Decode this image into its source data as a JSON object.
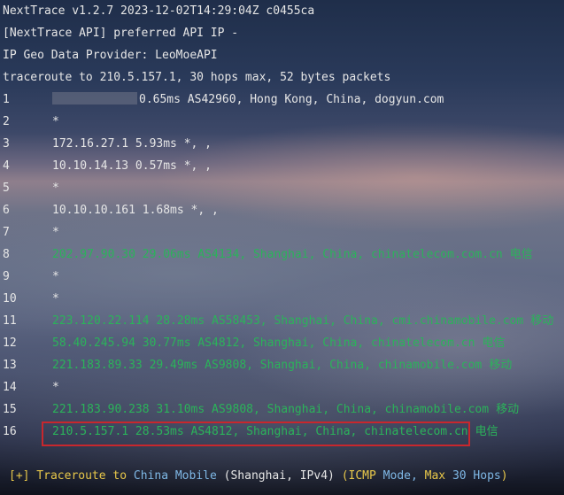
{
  "header": {
    "version_line": "NextTrace v1.2.7 2023-12-02T14:29:04Z c0455ca",
    "api_line": "[NextTrace API] preferred API IP -",
    "geo_line": "IP Geo Data Provider: LeoMoeAPI",
    "traceroute_line": "traceroute to 210.5.157.1, 30 hops max, 52 bytes packets"
  },
  "hops": [
    {
      "num": "1",
      "text": "0.65ms AS42960, Hong Kong, China, dogyun.com",
      "color": "#e6e6e6",
      "carrier": "",
      "masked": true
    },
    {
      "num": "2",
      "text": "*",
      "color": "#e6e6e6",
      "carrier": "",
      "masked": false
    },
    {
      "num": "3",
      "text": "172.16.27.1 5.93ms *, ,",
      "color": "#e6e6e6",
      "carrier": "",
      "masked": false
    },
    {
      "num": "4",
      "text": "10.10.14.13 0.57ms *, ,",
      "color": "#e6e6e6",
      "carrier": "",
      "masked": false
    },
    {
      "num": "5",
      "text": "*",
      "color": "#e6e6e6",
      "carrier": "",
      "masked": false
    },
    {
      "num": "6",
      "text": "10.10.10.161 1.68ms *, ,",
      "color": "#e6e6e6",
      "carrier": "",
      "masked": false
    },
    {
      "num": "7",
      "text": "*",
      "color": "#e6e6e6",
      "carrier": "",
      "masked": false
    },
    {
      "num": "8",
      "text": "202.97.90.30 29.06ms AS4134, Shanghai, China, chinatelecom.com.cn",
      "color": "#2bb35a",
      "carrier": "电信",
      "masked": false
    },
    {
      "num": "9",
      "text": "*",
      "color": "#e6e6e6",
      "carrier": "",
      "masked": false
    },
    {
      "num": "10",
      "text": "*",
      "color": "#e6e6e6",
      "carrier": "",
      "masked": false
    },
    {
      "num": "11",
      "text": "223.120.22.114 28.28ms AS58453, Shanghai, China, cmi.chinamobile.com",
      "color": "#2bb35a",
      "carrier": "移动",
      "masked": false
    },
    {
      "num": "12",
      "text": "58.40.245.94 30.77ms AS4812, Shanghai, China, chinatelecom.cn",
      "color": "#2bb35a",
      "carrier": "电信",
      "masked": false
    },
    {
      "num": "13",
      "text": "221.183.89.33 29.49ms AS9808, Shanghai, China, chinamobile.com",
      "color": "#2bb35a",
      "carrier": "移动",
      "masked": false
    },
    {
      "num": "14",
      "text": "*",
      "color": "#e6e6e6",
      "carrier": "",
      "masked": false
    },
    {
      "num": "15",
      "text": "221.183.90.238 31.10ms AS9808, Shanghai, China, chinamobile.com",
      "color": "#2bb35a",
      "carrier": "移动",
      "masked": false
    },
    {
      "num": "16",
      "text": "210.5.157.1 28.53ms AS4812, Shanghai, China, chinatelecom.cn",
      "color": "#2bb35a",
      "carrier": "电信",
      "masked": false
    }
  ],
  "footer": {
    "prefix": "[+]",
    "part1": " Traceroute to ",
    "target": "China Mobile",
    "part2": " (Shanghai, IPv4) ",
    "part3": "(ICMP ",
    "mode_word": "Mode,",
    "part4": " Max ",
    "max_hops": "30 Hops",
    "close": ")"
  },
  "colors": {
    "default_text": "#e6e6e6",
    "hop_green": "#2bb35a",
    "highlight_border": "#c8272d",
    "footer_yellow": "#e8c84a",
    "footer_blue": "#7fb8e6"
  }
}
